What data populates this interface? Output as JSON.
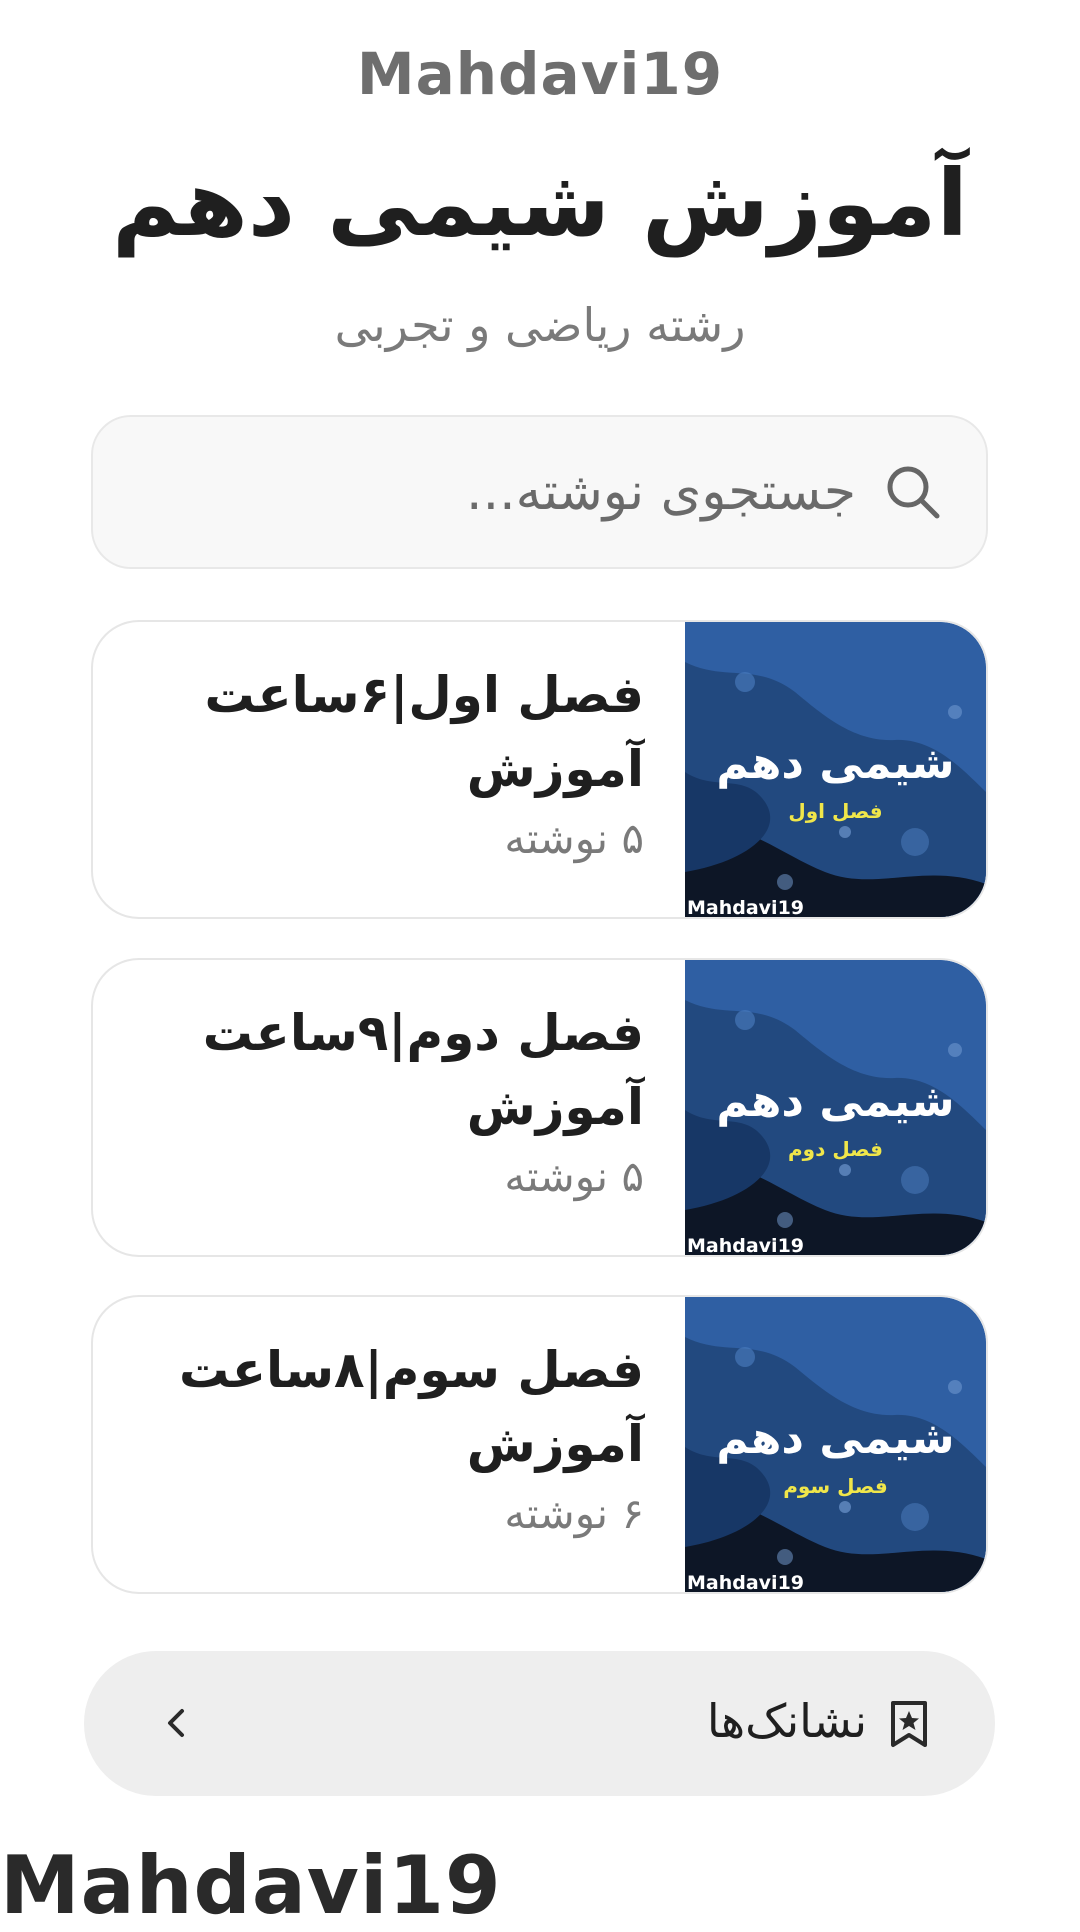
{
  "brand": {
    "top": "Mahdavi19",
    "bottom": "Mahdavi19"
  },
  "header": {
    "title": "آموزش شیمی دهم",
    "subtitle": "رشته ریاضی و تجربی"
  },
  "search": {
    "placeholder": "جستجوی نوشته...",
    "icon": "search-icon"
  },
  "cards": [
    {
      "title_line1": "فصل اول|۶ساعت",
      "title_line2": "آموزش",
      "count": "۵ نوشته",
      "thumb_title": "شیمی دهم",
      "thumb_subtitle": "فصل اول",
      "thumb_brand": "Mahdavi19"
    },
    {
      "title_line1": "فصل دوم|۹ساعت",
      "title_line2": "آموزش",
      "count": "۵ نوشته",
      "thumb_title": "شیمی دهم",
      "thumb_subtitle": "فصل دوم",
      "thumb_brand": "Mahdavi19"
    },
    {
      "title_line1": "فصل سوم|۸ساعت",
      "title_line2": "آموزش",
      "count": "۶ نوشته",
      "thumb_title": "شیمی دهم",
      "thumb_subtitle": "فصل سوم",
      "thumb_brand": "Mahdavi19"
    }
  ],
  "bookmarks": {
    "label": "نشانک‌ها",
    "icon": "bookmark-star-icon",
    "chevron": "chevron-left-icon"
  },
  "colors": {
    "thumb_blue": "#2f5fa3",
    "thumb_dark": "#0d1626",
    "thumb_subtitle_yellow": "#f0e64a",
    "bar_background": "#eeeeee"
  }
}
